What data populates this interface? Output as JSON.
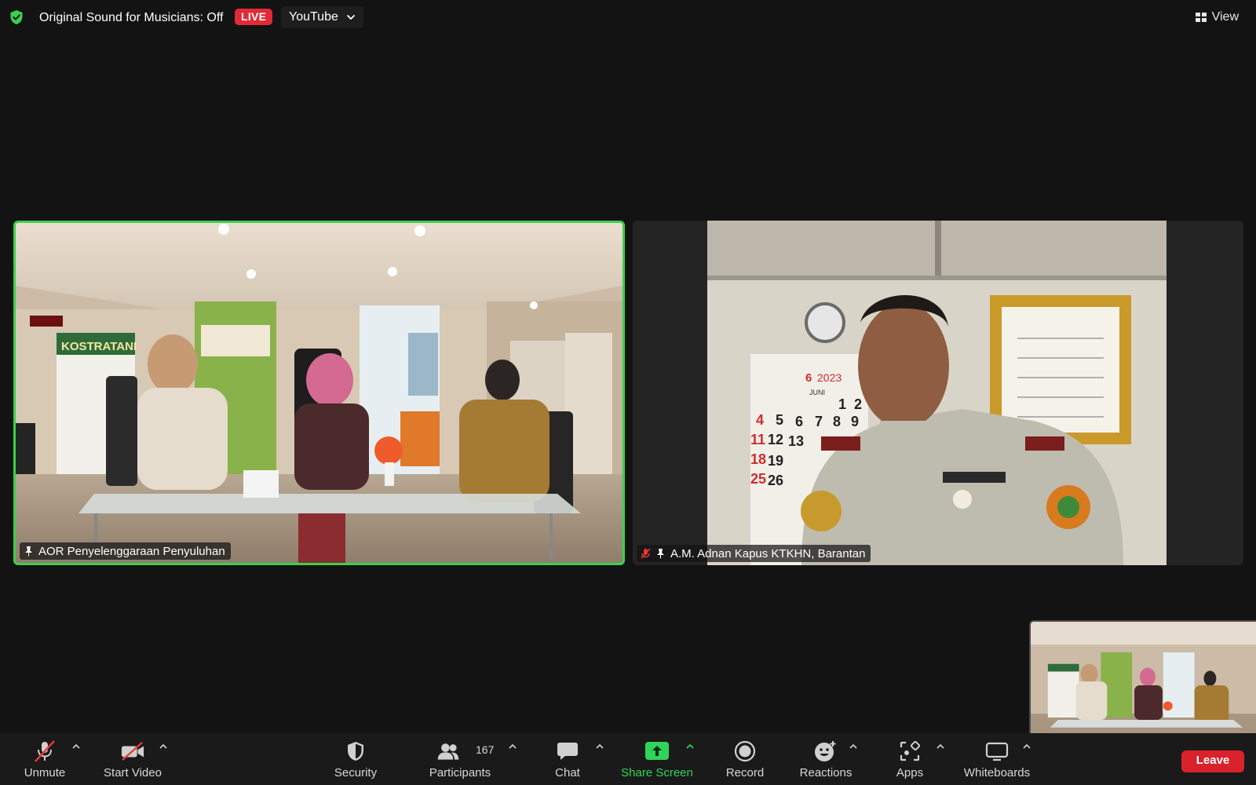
{
  "top_bar": {
    "security_icon": "shield-check-icon",
    "original_sound": "Original Sound for Musicians: Off",
    "live_badge": "LIVE",
    "stream_target": "YouTube",
    "view_label": "View",
    "accent_green": "#3ccf4e",
    "live_red": "#e02b37"
  },
  "tiles": [
    {
      "participant": "AOR Penyelenggaraan Penyuluhan",
      "pinned": true,
      "muted": false,
      "active_speaker": true,
      "banners": [
        "KOSTRATANI"
      ]
    },
    {
      "participant": "A.M. Adnan Kapus KTKHN, Barantan",
      "pinned": true,
      "muted": true,
      "active_speaker": false,
      "calendar": {
        "month_number": "6",
        "year": "2023",
        "month_name": "JUNI",
        "days": [
          "1",
          "2",
          "4",
          "5",
          "6",
          "7",
          "8",
          "9",
          "11",
          "12",
          "13",
          "18",
          "19",
          "25",
          "26"
        ]
      }
    }
  ],
  "toolbar": {
    "unmute": "Unmute",
    "start_video": "Start Video",
    "security": "Security",
    "participants": "Participants",
    "participant_count": "167",
    "chat": "Chat",
    "share_screen": "Share Screen",
    "record": "Record",
    "reactions": "Reactions",
    "apps": "Apps",
    "whiteboards": "Whiteboards",
    "leave": "Leave",
    "share_green": "#31d45a",
    "leave_red": "#d9222c"
  }
}
